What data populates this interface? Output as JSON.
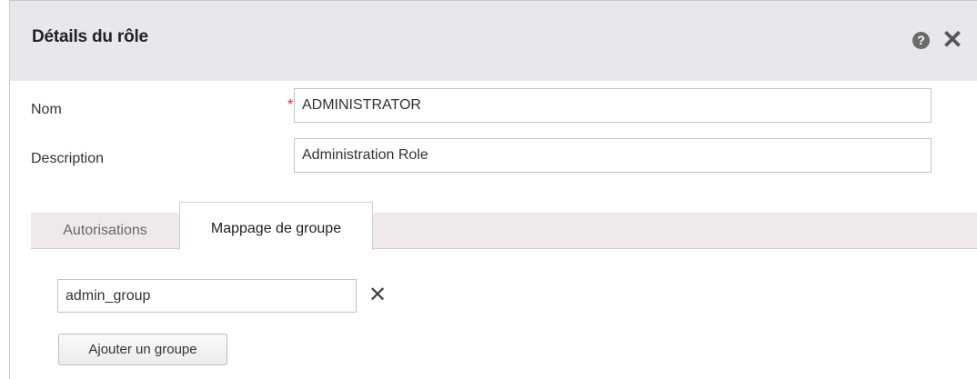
{
  "dialog": {
    "title": "Détails du rôle",
    "help_icon": "?",
    "close_icon": "✕"
  },
  "form": {
    "name_label": "Nom",
    "name_required_mark": "*",
    "name_value": "ADMINISTRATOR",
    "description_label": "Description",
    "description_value": "Administration Role"
  },
  "tabs": [
    {
      "label": "Autorisations",
      "active": false
    },
    {
      "label": "Mappage de groupe",
      "active": true
    }
  ],
  "group_mapping": {
    "groups": [
      "admin_group"
    ],
    "remove_icon": "✕",
    "add_button_label": "Ajouter un groupe"
  },
  "colors": {
    "header_bg": "#e6e8ec",
    "tabbar_bg": "#efe9ec",
    "required": "#e0281e"
  }
}
